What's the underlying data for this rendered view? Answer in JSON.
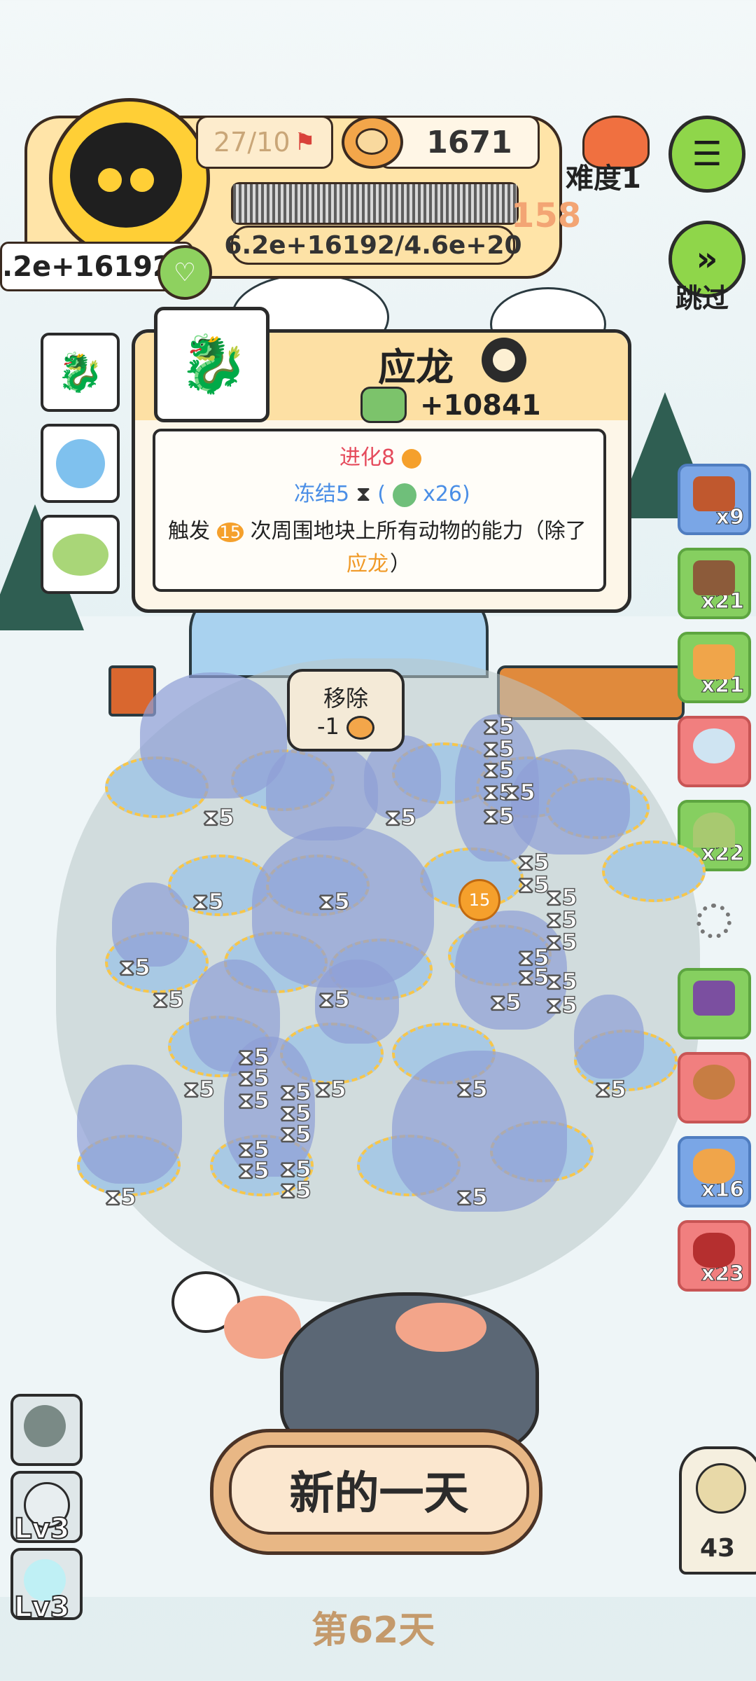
{
  "hud": {
    "flag_progress": "27/10",
    "coins": "1671",
    "money": ".2e+16192",
    "score_progress": "6.2e+16192/4.6e+20",
    "level": "158",
    "progress_fraction": 1.0,
    "difficulty_label": "难度1",
    "skip_label": "跳过"
  },
  "popup": {
    "title": "应龙",
    "value": "+10841",
    "evolve": "进化8",
    "freeze": "冻结5",
    "freeze_paren_open": "(",
    "freeze_multiplier": "x26)",
    "trigger_prefix": "触发",
    "trigger_count": "15",
    "trigger_text": "次周围地块上所有动物的能力（除了",
    "dragon_name": "应龙",
    "close_paren": "）"
  },
  "remove_bubble": {
    "label": "移除",
    "cost": "-1"
  },
  "board": {
    "hourglass_value": "5",
    "badge_value": "15"
  },
  "right_items": [
    {
      "icon": "fireplace-icon",
      "count": "x9",
      "color": "#7aa6e6"
    },
    {
      "icon": "coffee-cup-icon",
      "count": "x21",
      "color": "#86cf60"
    },
    {
      "icon": "ticket-icon",
      "count": "x21",
      "color": "#86cf60"
    },
    {
      "icon": "cloud-pearl-icon",
      "count": "",
      "color": "#f17f7f"
    },
    {
      "icon": "tent-icon",
      "count": "x22",
      "color": "#86cf60"
    },
    {
      "icon": "credit-card-icon",
      "count": "",
      "color": "#86cf60"
    },
    {
      "icon": "gingerbread-icon",
      "count": "",
      "color": "#f17f7f"
    },
    {
      "icon": "fist-icon",
      "count": "x16",
      "color": "#7aa6e6"
    },
    {
      "icon": "gift-sack-icon",
      "count": "x23",
      "color": "#f17f7f"
    }
  ],
  "bottom": {
    "new_day": "新的一天",
    "day_label": "第62天",
    "lv_1": "Lv3",
    "lv_2": "Lv3",
    "owl_count": "43"
  }
}
